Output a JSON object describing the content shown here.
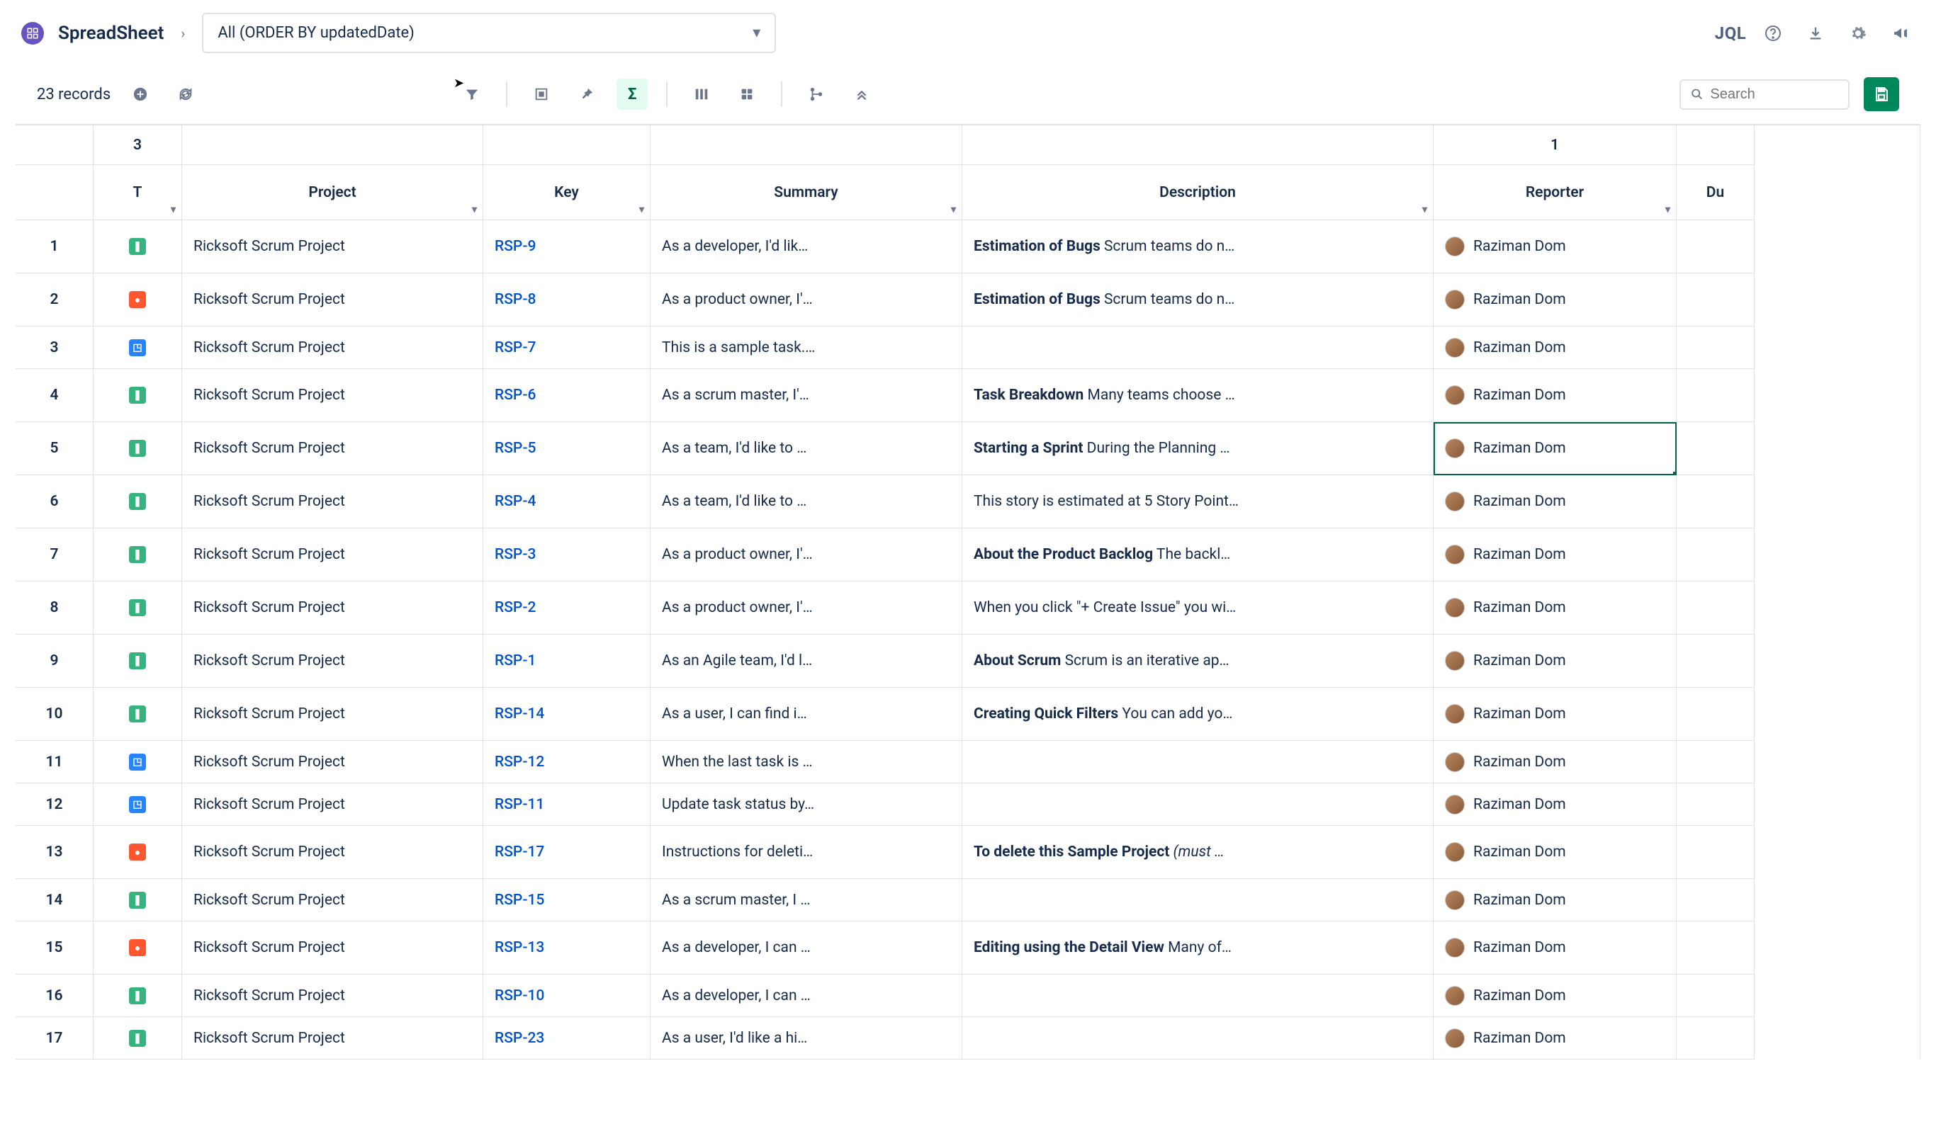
{
  "header": {
    "app_title": "SpreadSheet",
    "filter_label": "All (ORDER BY updatedDate)",
    "jql_label": "JQL"
  },
  "toolbar": {
    "record_count": "23 records",
    "search_placeholder": "Search",
    "badge_type": "3",
    "badge_reporter": "1"
  },
  "columns": {
    "type": "T",
    "project": "Project",
    "key": "Key",
    "summary": "Summary",
    "description": "Description",
    "reporter": "Reporter",
    "due": "Du"
  },
  "rows": [
    {
      "n": "1",
      "type": "story",
      "project": "Ricksoft Scrum Project",
      "key": "RSP-9",
      "summary": "As a developer, I'd lik…",
      "desc_bold": "Estimation of Bugs",
      "desc_rest": " Scrum teams do n…",
      "reporter": "Raziman Dom"
    },
    {
      "n": "2",
      "type": "bug",
      "project": "Ricksoft Scrum Project",
      "key": "RSP-8",
      "summary": "As a product owner, I'…",
      "desc_bold": "Estimation of Bugs",
      "desc_rest": " Scrum teams do n…",
      "reporter": "Raziman Dom"
    },
    {
      "n": "3",
      "type": "task",
      "project": "Ricksoft Scrum Project",
      "key": "RSP-7",
      "summary": "This is a sample task.…",
      "desc_bold": "",
      "desc_rest": "",
      "reporter": "Raziman Dom"
    },
    {
      "n": "4",
      "type": "story",
      "project": "Ricksoft Scrum Project",
      "key": "RSP-6",
      "summary": "As a scrum master, I'…",
      "desc_bold": "Task Breakdown",
      "desc_rest": " Many teams choose …",
      "reporter": "Raziman Dom"
    },
    {
      "n": "5",
      "type": "story",
      "project": "Ricksoft Scrum Project",
      "key": "RSP-5",
      "summary": "As a team, I'd like to …",
      "desc_bold": "Starting a Sprint",
      "desc_rest": " During the Planning …",
      "reporter": "Raziman Dom",
      "selected": true
    },
    {
      "n": "6",
      "type": "story",
      "project": "Ricksoft Scrum Project",
      "key": "RSP-4",
      "summary": "As a team, I'd like to …",
      "desc_bold": "",
      "desc_rest": "This story is estimated at 5 Story Point…",
      "reporter": "Raziman Dom"
    },
    {
      "n": "7",
      "type": "story",
      "project": "Ricksoft Scrum Project",
      "key": "RSP-3",
      "summary": "As a product owner, I'…",
      "desc_bold": "About the Product Backlog",
      "desc_rest": " The backl…",
      "reporter": "Raziman Dom"
    },
    {
      "n": "8",
      "type": "story",
      "project": "Ricksoft Scrum Project",
      "key": "RSP-2",
      "summary": "As a product owner, I'…",
      "desc_bold": "",
      "desc_rest": "When you click \"+ Create Issue\" you wi…",
      "reporter": "Raziman Dom"
    },
    {
      "n": "9",
      "type": "story",
      "project": "Ricksoft Scrum Project",
      "key": "RSP-1",
      "summary": "As an Agile team, I'd l…",
      "desc_bold": "About Scrum",
      "desc_rest": " Scrum is an iterative ap…",
      "reporter": "Raziman Dom"
    },
    {
      "n": "10",
      "type": "story",
      "project": "Ricksoft Scrum Project",
      "key": "RSP-14",
      "summary": "As a user, I can find i…",
      "desc_bold": "Creating Quick Filters",
      "desc_rest": " You can add yo…",
      "reporter": "Raziman Dom"
    },
    {
      "n": "11",
      "type": "task",
      "project": "Ricksoft Scrum Project",
      "key": "RSP-12",
      "summary": "When the last task is …",
      "desc_bold": "",
      "desc_rest": "",
      "reporter": "Raziman Dom"
    },
    {
      "n": "12",
      "type": "task",
      "project": "Ricksoft Scrum Project",
      "key": "RSP-11",
      "summary": "Update task status by…",
      "desc_bold": "",
      "desc_rest": "",
      "reporter": "Raziman Dom"
    },
    {
      "n": "13",
      "type": "bug",
      "project": "Ricksoft Scrum Project",
      "key": "RSP-17",
      "summary": "Instructions for deleti…",
      "desc_bold": "To delete this Sample Project",
      "desc_rest": "",
      "desc_italic": " (must …",
      "reporter": "Raziman Dom"
    },
    {
      "n": "14",
      "type": "story",
      "project": "Ricksoft Scrum Project",
      "key": "RSP-15",
      "summary": "As a scrum master, I …",
      "desc_bold": "",
      "desc_rest": "",
      "reporter": "Raziman Dom"
    },
    {
      "n": "15",
      "type": "bug",
      "project": "Ricksoft Scrum Project",
      "key": "RSP-13",
      "summary": "As a developer, I can …",
      "desc_bold": "Editing using the Detail View",
      "desc_rest": " Many of…",
      "reporter": "Raziman Dom"
    },
    {
      "n": "16",
      "type": "story",
      "project": "Ricksoft Scrum Project",
      "key": "RSP-10",
      "summary": "As a developer, I can …",
      "desc_bold": "",
      "desc_rest": "",
      "reporter": "Raziman Dom"
    },
    {
      "n": "17",
      "type": "story",
      "project": "Ricksoft Scrum Project",
      "key": "RSP-23",
      "summary": "As a user, I'd like a hi…",
      "desc_bold": "",
      "desc_rest": "",
      "reporter": "Raziman Dom"
    }
  ]
}
